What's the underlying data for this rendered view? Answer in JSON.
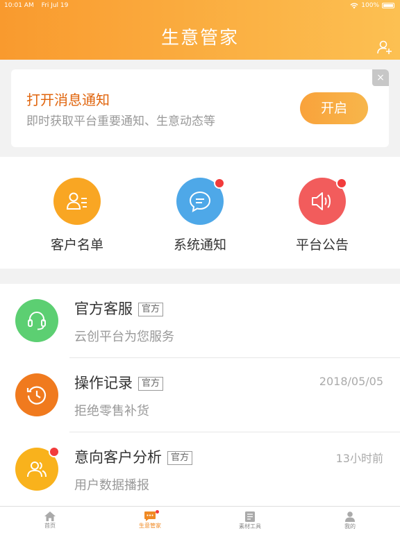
{
  "status": {
    "time": "10:01 AM",
    "date": "Fri Jul 19",
    "battery": "100%"
  },
  "header": {
    "title": "生意管家"
  },
  "notify": {
    "title": "打开消息通知",
    "subtitle": "即时获取平台重要通知、生意动态等",
    "button": "开启",
    "close": "×"
  },
  "quick": [
    {
      "label": "客户名单",
      "color": "#f9a623",
      "has_dot": false
    },
    {
      "label": "系统通知",
      "color": "#4ea8e8",
      "has_dot": true
    },
    {
      "label": "平台公告",
      "color": "#f25c5c",
      "has_dot": true
    }
  ],
  "messages": [
    {
      "title": "官方客服",
      "tag": "官方",
      "subtitle": "云创平台为您服务",
      "time": "",
      "color": "#5ccf72",
      "icon": "headset-icon"
    },
    {
      "title": "操作记录",
      "tag": "官方",
      "subtitle": "拒绝零售补货",
      "time": "2018/05/05",
      "color": "#f07a1e",
      "icon": "history-icon"
    },
    {
      "title": "意向客户分析",
      "tag": "官方",
      "subtitle": "用户数据播报",
      "time": "13小时前",
      "color": "#f9b21c",
      "icon": "users-icon"
    }
  ],
  "tabs": [
    {
      "label": "首页",
      "active": false
    },
    {
      "label": "生意管家",
      "active": true
    },
    {
      "label": "素材工具",
      "active": false
    },
    {
      "label": "我的",
      "active": false
    }
  ]
}
